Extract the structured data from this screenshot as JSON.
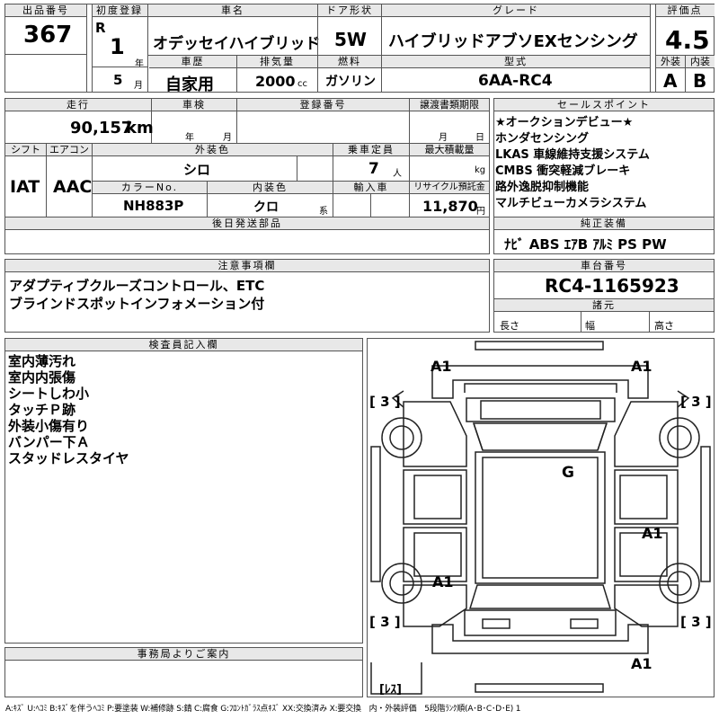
{
  "header": {
    "lot_label": "出品番号",
    "lot_no": "367",
    "first_reg_label": "初度登録",
    "era": "R",
    "year": "1",
    "year_unit": "年",
    "month": "5",
    "month_unit": "月",
    "car_name_label": "車名",
    "car_name": "オデッセイハイブリッド",
    "door_label": "ドア形状",
    "door": "5W",
    "grade_label": "グレード",
    "grade": "ハイブリッドアブソEXセンシング",
    "score_label": "評価点",
    "score": "4.5",
    "history_label": "車歴",
    "history": "自家用",
    "displacement_label": "排気量",
    "displacement": "2000",
    "displacement_unit": "cc",
    "fuel_label": "燃料",
    "fuel": "ガソリン",
    "model_label": "型式",
    "model": "6AA-RC4",
    "ext_label": "外装",
    "int_label": "内装",
    "ext_grade": "A",
    "int_grade": "B"
  },
  "row2": {
    "mileage_label": "走行",
    "mileage": "90,157",
    "mileage_unit": "km",
    "shaken_label": "車検",
    "shaken_year": "年",
    "shaken_month": "月",
    "regno_label": "登録番号",
    "transfer_label": "譲渡書類期限",
    "transfer_month": "月",
    "transfer_day": "日",
    "shift_label": "シフト",
    "shift": "IAT",
    "ac_label": "エアコン",
    "ac": "AAC",
    "ext_color_label": "外装色",
    "ext_color": "シロ",
    "capacity_label": "乗車定員",
    "capacity": "7",
    "capacity_unit": "人",
    "load_label": "最大積載量",
    "load_unit": "kg",
    "color_no_label": "カラーNo.",
    "color_no": "NH883P",
    "int_color_label": "内装色",
    "int_color": "クロ",
    "int_color_unit": "系",
    "import_label": "輸入車",
    "recycle_label": "リサイクル預託金",
    "recycle": "11,870",
    "recycle_unit": "円",
    "later_label": "後日発送部品"
  },
  "sales": {
    "label": "セールスポイント",
    "lines": [
      "★オークションデビュー★",
      "ホンダセンシング",
      "LKAS 車線維持支援システム",
      "CMBS 衝突軽減ブレーキ",
      "路外逸脱抑制機能",
      "マルチビューカメラシステム"
    ]
  },
  "equipment": {
    "label": "純正装備",
    "items": "ﾅﾋﾞ ABS ｴｱB ｱﾙﾐ PS PW"
  },
  "notes": {
    "label": "注意事項欄",
    "lines": [
      "アダプティブクルーズコントロール、ETC",
      "ブラインドスポットインフォメーション付"
    ]
  },
  "chassis": {
    "label": "車台番号",
    "value": "RC4-1165923",
    "dims_label": "諸元",
    "length": "長さ",
    "width": "幅",
    "height": "高さ"
  },
  "inspector": {
    "label": "検査員記入欄",
    "lines": [
      "室内薄汚れ",
      "室内内張傷",
      "シートしわ小",
      "タッチＰ跡",
      "外装小傷有り",
      "バンパー下Ａ",
      "スタッドレスタイヤ"
    ]
  },
  "office": {
    "label": "事務局よりご案内"
  },
  "diagram": {
    "marks": {
      "front_left": "A1",
      "front_right": "A1",
      "tire_fl": "[ 3 ]",
      "tire_fr": "[ 3 ]",
      "roof": "G",
      "door_right": "A1",
      "door_left": "A1",
      "tire_rl": "[ 3 ]",
      "tire_rr": "[ 3 ]",
      "rear": "A1",
      "spare": "[ﾚｽ]"
    }
  },
  "footer": "A:ｷｽﾞ U:ﾍｺﾐ B:ｷｽﾞを伴うﾍｺﾐ P:要塗装 W:補修跡 S:錆 C:腐食 G:ﾌﾛﾝﾄｶﾞﾗｽ点ｷｽﾞ XX:交換済み X:要交換　内・外装評価　5段階ﾗﾝｸ順(A･B･C･D･E) 1"
}
